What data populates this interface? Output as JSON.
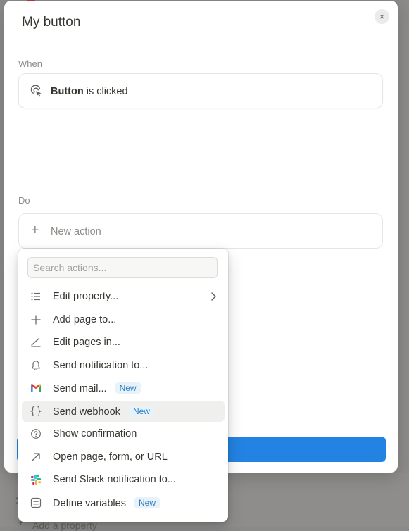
{
  "dialog": {
    "title": "My button",
    "close_glyph": "×",
    "when_label": "When",
    "do_label": "Do"
  },
  "trigger": {
    "icon": "cursor-click-icon",
    "subject": "Button",
    "predicate": " is clicked"
  },
  "new_action": {
    "icon": "plus-icon",
    "label": "New action"
  },
  "menu": {
    "search_placeholder": "Search actions...",
    "items": [
      {
        "label": "Edit property...",
        "icon": "list-icon",
        "badge": "",
        "chevron": true
      },
      {
        "label": "Add page to...",
        "icon": "plus-icon",
        "badge": ""
      },
      {
        "label": "Edit pages in...",
        "icon": "pencil-icon",
        "badge": ""
      },
      {
        "label": "Send notification to...",
        "icon": "bell-icon",
        "badge": ""
      },
      {
        "label": "Send mail...",
        "icon": "gmail-icon",
        "badge": "New"
      },
      {
        "label": "Send webhook",
        "icon": "braces-icon",
        "badge": "New",
        "hovered": true
      },
      {
        "label": "Show confirmation",
        "icon": "question-circle-icon",
        "badge": ""
      },
      {
        "label": "Open page, form, or URL",
        "icon": "arrow-up-right-icon",
        "badge": ""
      },
      {
        "label": "Send Slack notification to...",
        "icon": "slack-icon",
        "badge": ""
      },
      {
        "label": "Define variables",
        "icon": "variables-icon",
        "badge": "New"
      }
    ]
  },
  "background": {
    "peek_text": "Add a property"
  },
  "colors": {
    "accent": "#2383e2",
    "badge_bg": "#e7f3f8",
    "badge_text": "#2f7cc4",
    "hover_bg": "#efefee"
  }
}
